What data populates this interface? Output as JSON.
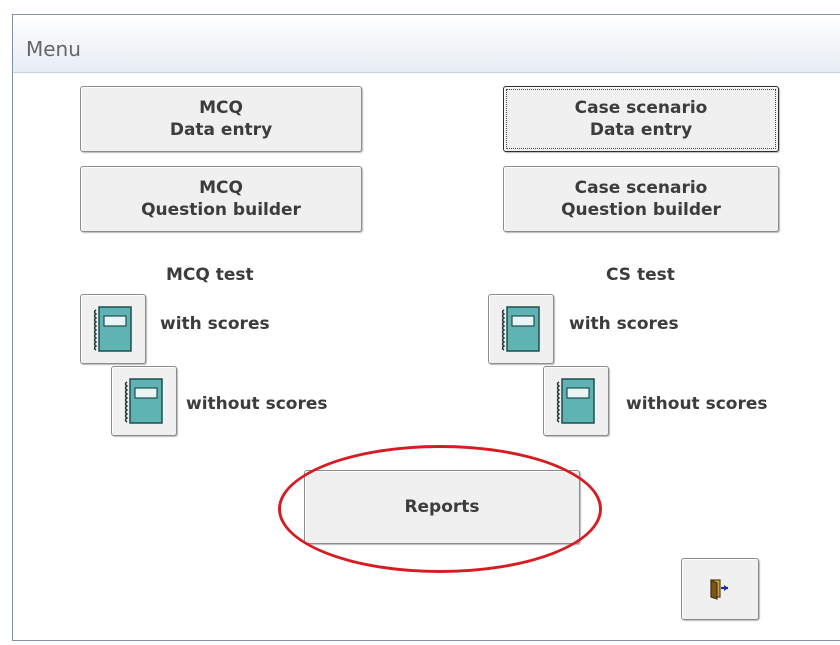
{
  "window": {
    "title": "Menu"
  },
  "buttons": {
    "mcq_data_entry": {
      "line1": "MCQ",
      "line2": "Data entry"
    },
    "cs_data_entry": {
      "line1": "Case scenario",
      "line2": "Data entry"
    },
    "mcq_question_builder": {
      "line1": "MCQ",
      "line2": "Question builder"
    },
    "cs_question_builder": {
      "line1": "Case scenario",
      "line2": "Question builder"
    },
    "reports": "Reports"
  },
  "mcq_test": {
    "heading": "MCQ test",
    "with_scores": "with scores",
    "without_scores": "without scores"
  },
  "cs_test": {
    "heading": "CS test",
    "with_scores": "with scores",
    "without_scores": "without scores"
  },
  "icons": {
    "test_button": "notebook-icon",
    "exit_button": "exit-door-icon"
  },
  "colors": {
    "highlight_ellipse": "#d81b22",
    "notebook": "#5fb3b3"
  }
}
